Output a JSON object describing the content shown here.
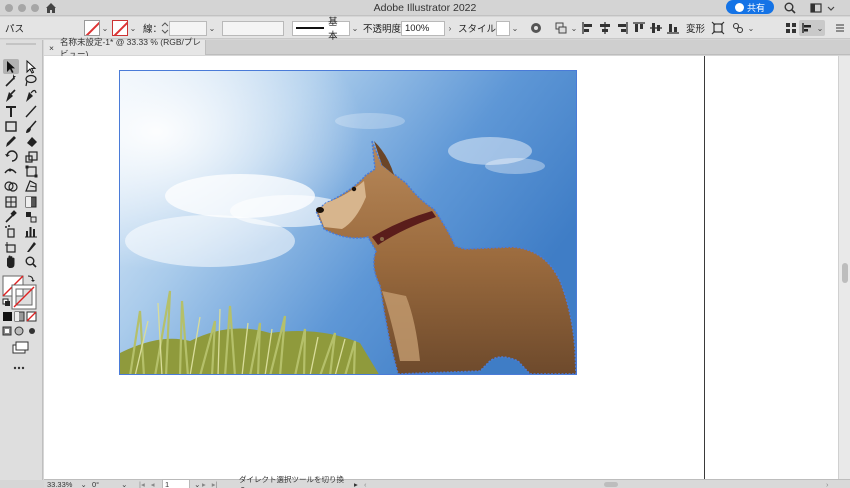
{
  "window": {
    "title": "Adobe Illustrator 2022",
    "share_label": "共有"
  },
  "controlbar": {
    "selection_type": "パス",
    "stroke_label": "線：",
    "brush_label": "基本",
    "opacity_label": "不透明度：",
    "opacity_value": "100%",
    "style_label": "スタイル：",
    "transform_label": "変形"
  },
  "document": {
    "tab_title": "名称未設定-1* @ 33.33 % (RGB/プレビュー)",
    "close_symbol": "×"
  },
  "statusbar": {
    "zoom": "33.33%",
    "rotation": "0°",
    "artboard": "1",
    "tool_status": "ダイレクト選択ツールを切り換え"
  },
  "colors": {
    "accent": "#1473e6",
    "selection": "#4a7bd8",
    "sky_top": "#4f8fd2",
    "sky_light": "#e9f2fb",
    "dog": "#9b6b3e",
    "grass": "#9aa545"
  },
  "icons": [
    "home-icon",
    "search-icon",
    "panel-layout-icon",
    "arrange-icon",
    "selection-tool-icon",
    "direct-selection-tool-icon",
    "magic-wand-icon",
    "lasso-icon",
    "pen-tool-icon",
    "curvature-tool-icon",
    "type-tool-icon",
    "line-tool-icon",
    "rectangle-tool-icon",
    "paintbrush-icon",
    "pencil-icon",
    "eraser-icon",
    "rotate-tool-icon",
    "scale-tool-icon",
    "width-tool-icon",
    "free-transform-icon",
    "shape-builder-icon",
    "perspective-grid-icon",
    "mesh-tool-icon",
    "gradient-tool-icon",
    "eyedropper-icon",
    "blend-tool-icon",
    "symbol-sprayer-icon",
    "column-graph-icon",
    "artboard-tool-icon",
    "slice-tool-icon",
    "hand-tool-icon",
    "zoom-tool-icon",
    "fill-swatch-icon",
    "stroke-swatch-icon",
    "more-tools-icon"
  ]
}
